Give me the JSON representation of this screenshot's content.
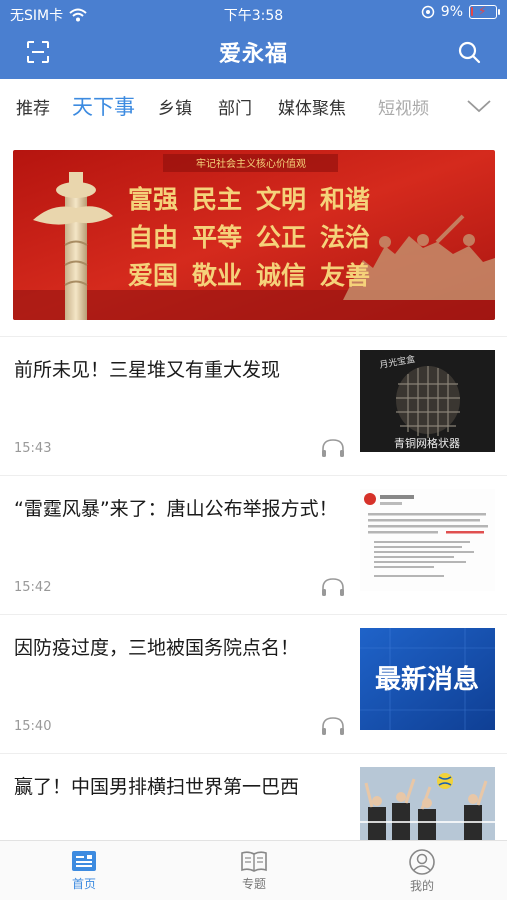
{
  "status_bar": {
    "carrier": "无SIM卡",
    "time": "下午3:58",
    "battery_percent": "9%",
    "battery_level": 0.09
  },
  "header": {
    "title": "爱永福"
  },
  "tabs": [
    {
      "label": "推荐"
    },
    {
      "label": "天下事"
    },
    {
      "label": "乡镇"
    },
    {
      "label": "部门"
    },
    {
      "label": "媒体聚焦"
    },
    {
      "label": "短视频"
    }
  ],
  "banner": {
    "caption": "牢记社会主义核心价值观",
    "values": [
      "富强",
      "民主",
      "文明",
      "和谐",
      "自由",
      "平等",
      "公正",
      "法治",
      "爱国",
      "敬业",
      "诚信",
      "友善"
    ]
  },
  "news": [
    {
      "title": "前所未见！三星堆又有重大发现",
      "time": "15:43",
      "thumb_text": "青铜网格状器"
    },
    {
      "title": "“雷霆风暴”来了：唐山公布举报方式！",
      "time": "15:42",
      "thumb_text": ""
    },
    {
      "title": "因防疫过度，三地被国务院点名！",
      "time": "15:40",
      "thumb_text": "最新消息"
    },
    {
      "title": "赢了！中国男排横扫世界第一巴西",
      "time": "",
      "thumb_text": ""
    }
  ],
  "bottom_nav": [
    {
      "label": "首页"
    },
    {
      "label": "专题"
    },
    {
      "label": "我的"
    }
  ],
  "colors": {
    "brand_blue": "#4a7fd0",
    "active_tab": "#3d8be0",
    "banner_red": "#c8211a",
    "banner_gold": "#f5d27a"
  }
}
